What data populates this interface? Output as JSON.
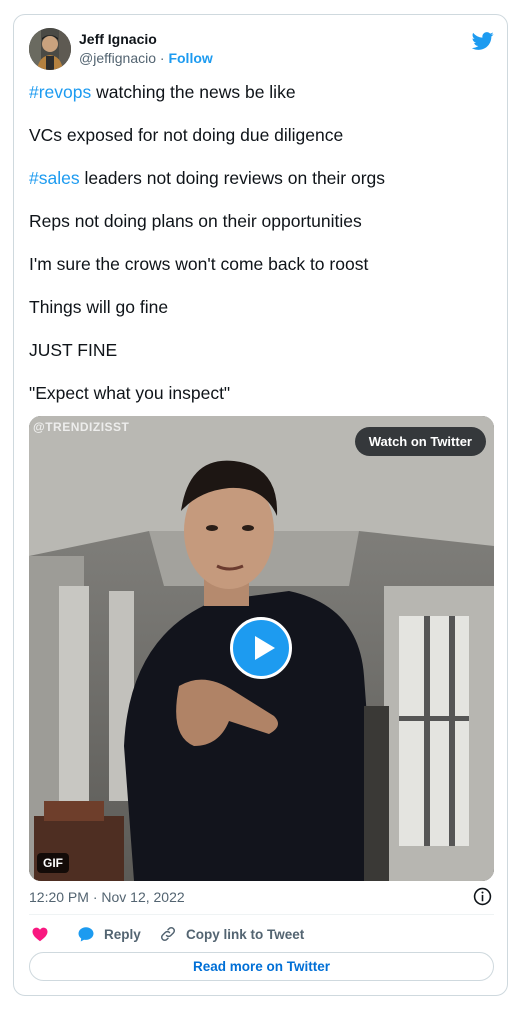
{
  "author": {
    "name": "Jeff Ignacio",
    "handle": "@jeffignacio",
    "separator": " · ",
    "follow_label": "Follow"
  },
  "tweet": {
    "lines": [
      {
        "hashtag": "#revops",
        "text": " watching the news be like"
      },
      {
        "hashtag": "",
        "text": "VCs exposed for not doing due diligence"
      },
      {
        "hashtag": "#sales",
        "text": " leaders not doing reviews on their orgs"
      },
      {
        "hashtag": "",
        "text": "Reps not doing plans on their opportunities"
      },
      {
        "hashtag": "",
        "text": "I'm sure the crows won't come back to roost"
      },
      {
        "hashtag": "",
        "text": "Things will go fine"
      },
      {
        "hashtag": "",
        "text": "JUST FINE"
      },
      {
        "hashtag": "",
        "text": "\"Expect what you inspect\""
      }
    ]
  },
  "media": {
    "watermark": "@TRENDIZISST",
    "watch_label": "Watch on Twitter",
    "gif_label": "GIF"
  },
  "footer": {
    "timestamp": "12:20 PM · Nov 12, 2022",
    "reply_label": "Reply",
    "copy_label": "Copy link to Tweet",
    "read_more_label": "Read more on Twitter"
  },
  "colors": {
    "accent": "#1d9bf0",
    "like": "#f91880",
    "text": "#0f1419",
    "muted": "#536471",
    "border": "#cfd9de"
  }
}
